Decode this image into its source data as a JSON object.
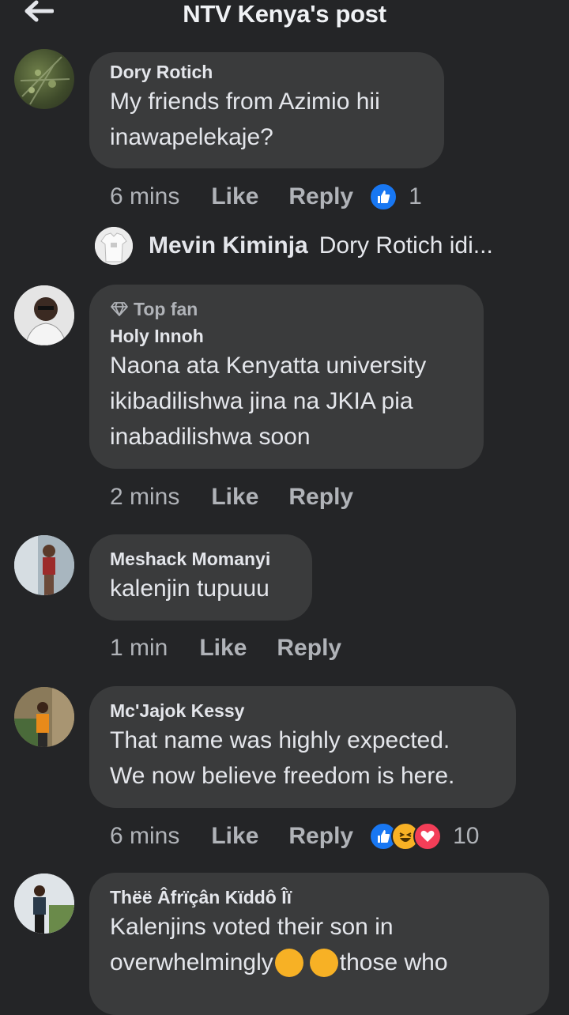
{
  "header": {
    "title": "NTV Kenya's post",
    "back_icon": "arrow-left-icon"
  },
  "comments": [
    {
      "author": "Dory Rotich",
      "lines": [
        "My friends from Azimio hii",
        "inawapelekaje?"
      ],
      "time": "6 mins",
      "like": "Like",
      "reply": "Reply",
      "reaction_count": "1"
    },
    {
      "badge": "Top fan",
      "author": "Holy Innoh",
      "lines": [
        "Naona ata Kenyatta university",
        "ikibadilishwa jina na JKIA pia",
        "inabadilishwa soon"
      ],
      "time": "2 mins",
      "like": "Like",
      "reply": "Reply"
    },
    {
      "author": "Meshack Momanyi",
      "lines": [
        "kalenjin tupuuu"
      ],
      "time": "1 min",
      "like": "Like",
      "reply": "Reply"
    },
    {
      "author": "Mc'Jajok Kessy",
      "lines": [
        "That name was highly expected.",
        "We now believe freedom is here."
      ],
      "time": "6 mins",
      "like": "Like",
      "reply": "Reply",
      "reaction_count": "10"
    },
    {
      "author": "Thëë Âfrïçân Kïddô Îï",
      "lines": [
        "Kalenjins voted their son in",
        "overwhelmingly",
        "those who"
      ]
    }
  ],
  "subreply": {
    "author": "Mevin Kiminja",
    "text": "Dory Rotich idi..."
  },
  "colors": {
    "background": "#242527",
    "bubble": "#3a3b3c",
    "like_blue": "#1877f2",
    "love_red": "#f33e58",
    "haha_yellow": "#f7b125"
  }
}
